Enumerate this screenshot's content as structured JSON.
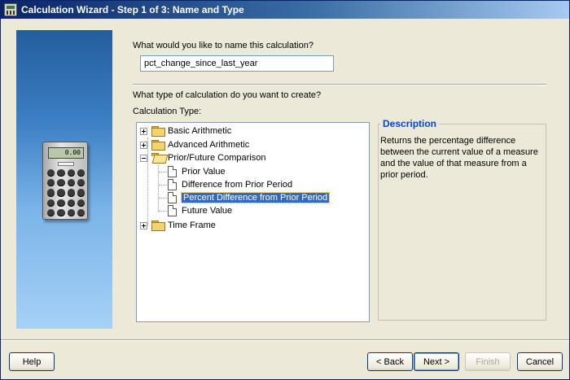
{
  "window": {
    "title": "Calculation Wizard - Step 1 of 3: Name and Type"
  },
  "banner": {
    "calculator_display": "0.00"
  },
  "name_section": {
    "prompt": "What would you like to name this calculation?",
    "value": "pct_change_since_last_year"
  },
  "type_section": {
    "prompt": "What type of calculation do you want to create?",
    "tree_label": "Calculation Type:"
  },
  "tree": {
    "basic_arithmetic": "Basic Arithmetic",
    "advanced_arithmetic": "Advanced Arithmetic",
    "prior_future": "Prior/Future Comparison",
    "children": [
      "Prior Value",
      "Difference from Prior Period",
      "Percent Difference from Prior Period",
      "Future Value"
    ],
    "time_frame": "Time Frame",
    "selected": "Percent Difference from Prior Period"
  },
  "description": {
    "title": "Description",
    "text": "Returns the percentage difference between the current value of a measure and the value of that measure from a prior period."
  },
  "buttons": {
    "help": "Help",
    "back": "< Back",
    "next": "Next >",
    "finish": "Finish",
    "cancel": "Cancel"
  },
  "colors": {
    "selection": "#316ac5",
    "description_title": "#0046d5",
    "titlebar_start": "#0a246a",
    "titlebar_end": "#a6caf0"
  }
}
